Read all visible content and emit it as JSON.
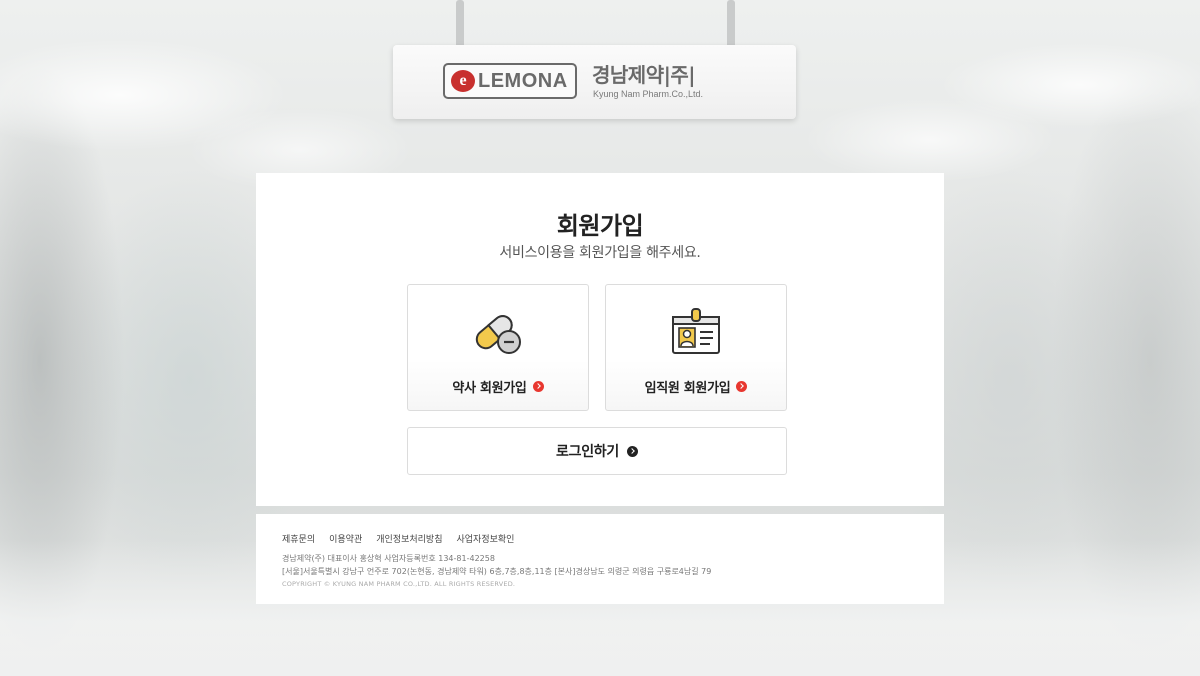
{
  "sign": {
    "brand_mark": "e",
    "brand_name": "LEMONA",
    "company_name": "경남제약|주|",
    "company_sub": "Kyung Nam Pharm.Co.,Ltd."
  },
  "card": {
    "title": "회원가입",
    "subtitle": "서비스이용을 회원가입을 해주세요.",
    "options": [
      {
        "label": "약사 회원가입",
        "icon": "pill-capsule-icon"
      },
      {
        "label": "임직원 회원가입",
        "icon": "employee-id-card-icon"
      }
    ],
    "login_label": "로그인하기"
  },
  "footer": {
    "links": [
      "제휴문의",
      "이용약관",
      "개인정보처리방침",
      "사업자정보확인"
    ],
    "info_line1": "경남제약(주) 대표이사 홍상혁 사업자등록번호 134-81-42258",
    "info_line2": "[서울]서울특별시 강남구 언주로 702(논현동, 경남제약 타워) 6층,7층,8층,11층 [본사]경상남도 의령군 의령읍 구룡로4남길 79",
    "copyright": "COPYRIGHT © KYUNG NAM PHARM CO.,LTD. ALL RIGHTS RESERVED."
  },
  "colors": {
    "accent_red": "#e8372f",
    "pill_yellow": "#f2c94c",
    "text_dark": "#222222"
  }
}
